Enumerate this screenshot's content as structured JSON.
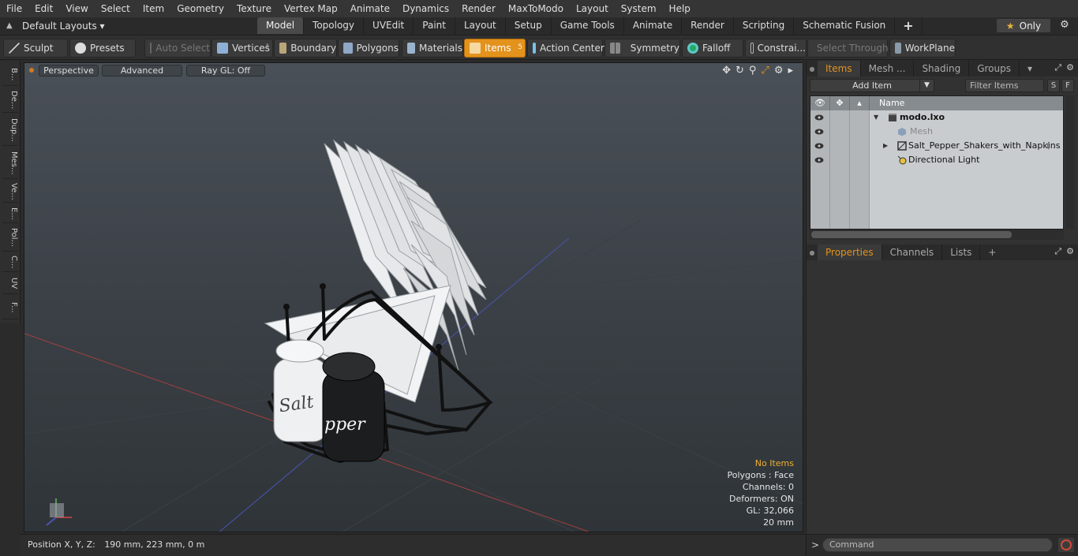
{
  "menu": [
    "File",
    "Edit",
    "View",
    "Select",
    "Item",
    "Geometry",
    "Texture",
    "Vertex Map",
    "Animate",
    "Dynamics",
    "Render",
    "MaxToModo",
    "Layout",
    "System",
    "Help"
  ],
  "layouts": {
    "label": "Default Layouts ▾"
  },
  "tabs": [
    "Model",
    "Topology",
    "UVEdit",
    "Paint",
    "Layout",
    "Setup",
    "Game Tools",
    "Animate",
    "Render",
    "Scripting",
    "Schematic Fusion",
    "+"
  ],
  "active_tab": "Model",
  "only_button": "Only",
  "toolbar": {
    "sculpt": "Sculpt",
    "presets": "Presets",
    "auto_select": "Auto Select",
    "vertices": "Vertices",
    "vertices_count": "1",
    "boundary": "Boundary",
    "polygons": "Polygons",
    "materials": "Materials",
    "items": "Items",
    "items_count": "5",
    "action_center": "Action Center",
    "symmetry": "Symmetry",
    "falloff": "Falloff",
    "constraints": "Constrai...",
    "select_through": "Select Through",
    "workplane": "WorkPlane"
  },
  "left_strip": [
    "B...",
    "De...",
    "Dup...",
    "Mes...",
    "Ve...",
    "E...",
    "Pol...",
    "C...",
    "UV",
    "F..."
  ],
  "viewport": {
    "view_mode": "Perspective",
    "shading": "Advanced",
    "raygl": "Ray GL: Off",
    "info": {
      "selection": "No Items",
      "polygons": "Polygons : Face",
      "channels": "Channels: 0",
      "deformers": "Deformers: ON",
      "gl": "GL: 32,066",
      "scale": "20 mm"
    },
    "shaker_salt_label": "Salt",
    "shaker_pepper_label": "pper"
  },
  "status": {
    "label": "Position X, Y, Z:",
    "value": "190 mm, 223 mm, 0 m"
  },
  "right_panel": {
    "top_tabs": [
      "Items",
      "Mesh ...",
      "Shading",
      "Groups"
    ],
    "active_top_tab": "Items",
    "add_item": "Add Item",
    "filter_items": "Filter Items",
    "s_btn": "S",
    "f_btn": "F",
    "tree_header_name": "Name",
    "tree": [
      {
        "label": "modo.lxo",
        "bold": true
      },
      {
        "label": "Mesh",
        "dim": true
      },
      {
        "label": "Salt_Pepper_Shakers_with_Napkins",
        "suffix": "( ..."
      },
      {
        "label": "Directional Light"
      }
    ],
    "bottom_tabs": [
      "Properties",
      "Channels",
      "Lists",
      "+"
    ],
    "active_bottom_tab": "Properties",
    "command_placeholder": "Command"
  }
}
